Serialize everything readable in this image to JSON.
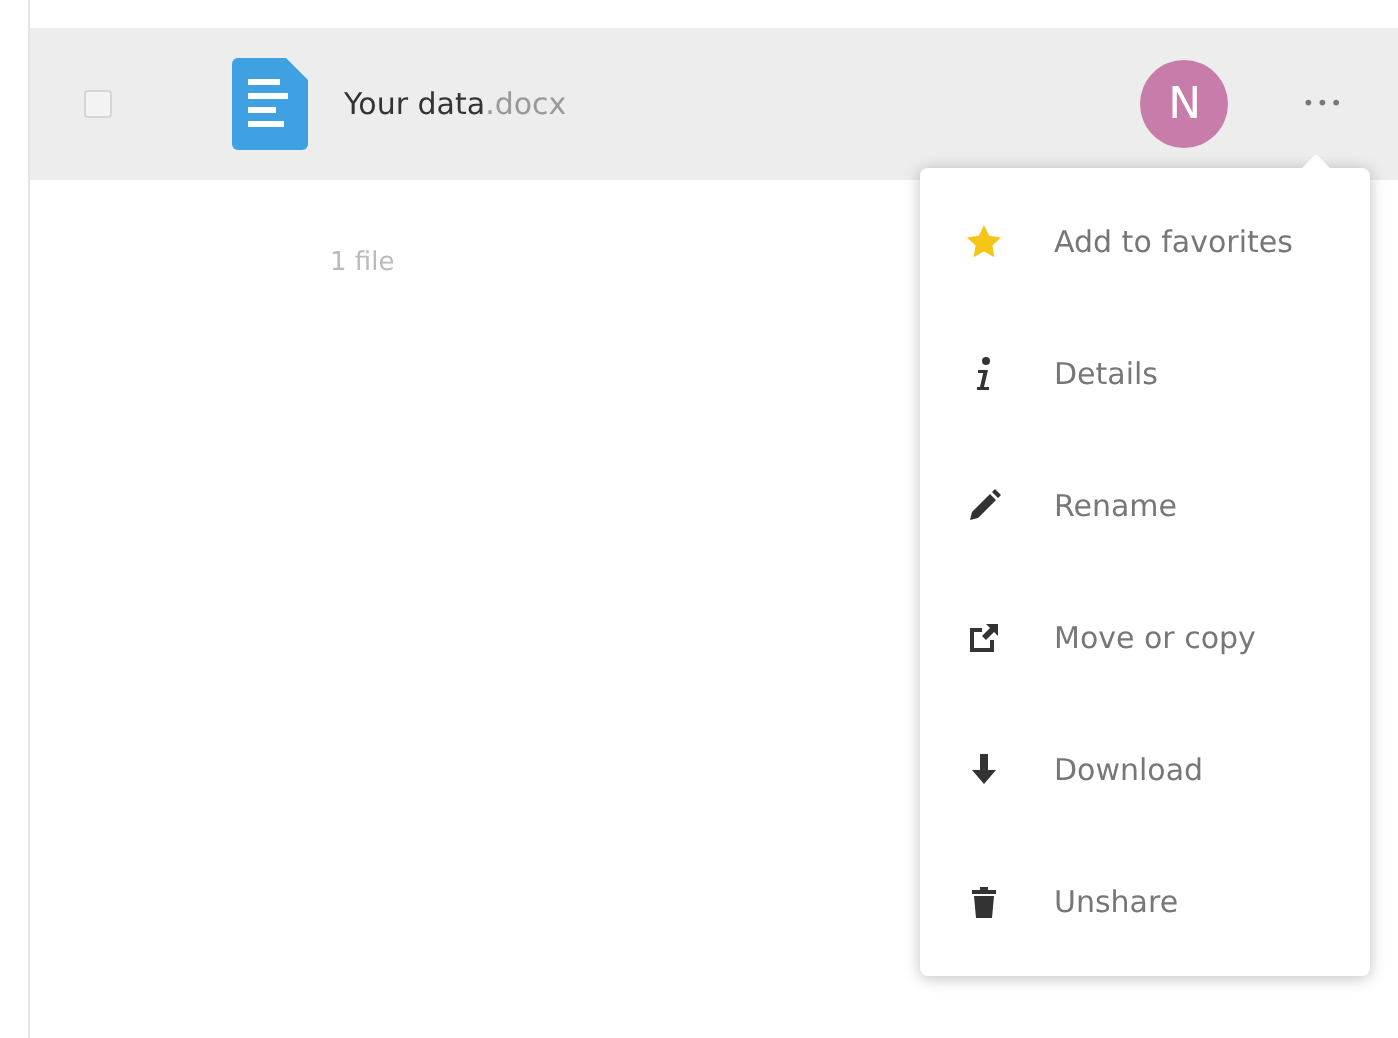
{
  "file_row": {
    "checked": false,
    "name": "Your data",
    "extension": ".docx",
    "avatar": "N",
    "more": "•••"
  },
  "summary": "1 file",
  "menu": [
    {
      "kind": "star",
      "label": "Add to favorites"
    },
    {
      "kind": "info",
      "label": "Details"
    },
    {
      "kind": "pencil",
      "label": "Rename"
    },
    {
      "kind": "move",
      "label": "Move or copy"
    },
    {
      "kind": "download",
      "label": "Download"
    },
    {
      "kind": "trash",
      "label": "Unshare"
    }
  ]
}
